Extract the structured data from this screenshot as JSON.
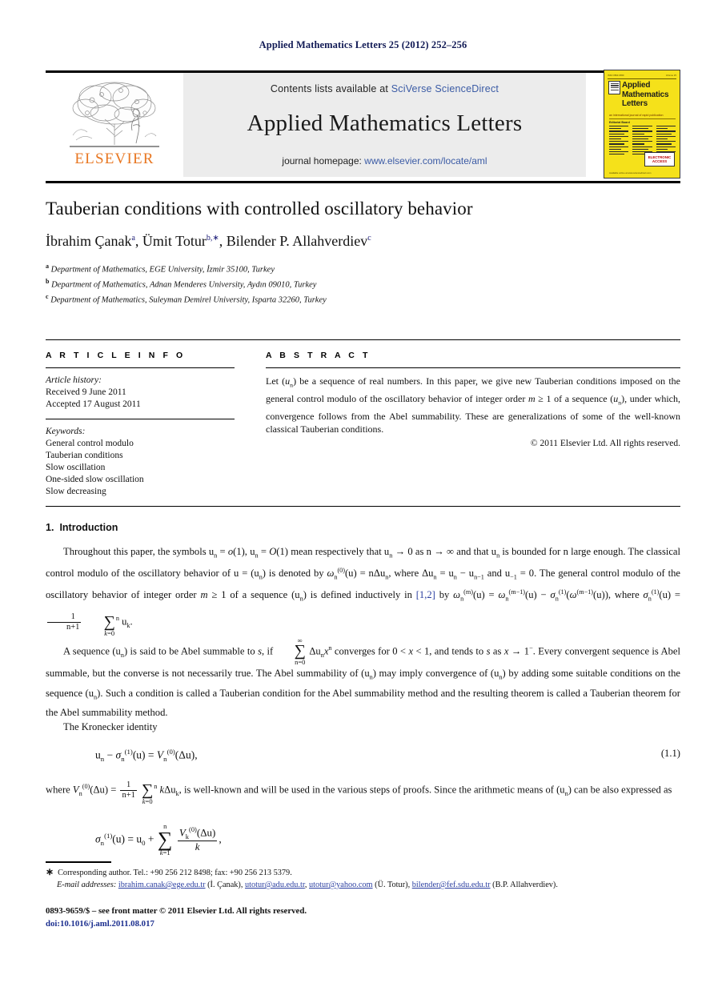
{
  "running_head": "Applied Mathematics Letters 25 (2012) 252–256",
  "masthead": {
    "publisher_name": "ELSEVIER",
    "contents_prefix": "Contents lists available at ",
    "contents_link": "SciVerse ScienceDirect",
    "journal_title": "Applied Mathematics Letters",
    "homepage_prefix": "journal homepage: ",
    "homepage_link": "www.elsevier.com/locate/aml",
    "cover": {
      "title": "Applied Mathematics Letters",
      "subtitle": "an international journal of rapid publication",
      "board_label": "Editorial Board",
      "access_badge": "ELECTRONIC ACCESS",
      "top_left": "ISSN 0893-9659",
      "top_right": "Volume 25",
      "footer": "Available online at www.sciencedirect.com"
    }
  },
  "article": {
    "title": "Tauberian conditions with controlled oscillatory behavior",
    "authors": [
      {
        "name": "İbrahim Çanak",
        "marks": "a"
      },
      {
        "name": "Ümit Totur",
        "marks": "b"
      },
      {
        "name": "Bilender P. Allahverdiev",
        "marks": "c"
      }
    ],
    "authors_line_prefix": "İbrahim Çanak",
    "affiliations": [
      {
        "mark": "a",
        "text": "Department of Mathematics, EGE University, İzmir 35100, Turkey"
      },
      {
        "mark": "b",
        "text": "Department of Mathematics, Adnan Menderes University, Aydın 09010, Turkey"
      },
      {
        "mark": "c",
        "text": "Department of Mathematics, Suleyman Demirel University, Isparta 32260, Turkey"
      }
    ]
  },
  "info": {
    "heading": "A R T I C L E   I N F O",
    "history_label": "Article history:",
    "history": [
      "Received 9 June 2011",
      "Accepted 17 August 2011"
    ],
    "keywords_label": "Keywords:",
    "keywords": [
      "General control modulo",
      "Tauberian conditions",
      "Slow oscillation",
      "One-sided slow oscillation",
      "Slow decreasing"
    ]
  },
  "abstract": {
    "heading": "A B S T R A C T",
    "text": "Let (uₙ) be a sequence of real numbers. In this paper, we give new Tauberian conditions imposed on the general control modulo of the oscillatory behavior of integer order m ≥ 1 of a sequence (uₙ), under which, convergence follows from the Abel summability. These are generalizations of some of the well-known classical Tauberian conditions.",
    "copyright": "© 2011 Elsevier Ltd. All rights reserved."
  },
  "sections": {
    "intro": {
      "number": "1.",
      "title": "Introduction",
      "p1_a": "Throughout this paper, the symbols u",
      "p1_full": "Throughout this paper, the symbols uₙ = o(1), uₙ = O(1) mean respectively that uₙ → 0 as n → ∞ and that uₙ is bounded for n large enough. The classical control modulo of the oscillatory behavior of u = (uₙ) is denoted by ω⁽⁰⁾ₙ(u) = nΔuₙ, where Δuₙ = uₙ − uₙ₋₁ and u₋₁ = 0. The general control modulo of the oscillatory behavior of integer order m ≥ 1 of a sequence (uₙ) is defined inductively in [1,2] by ω⁽ᵐ⁾ₙ(u) = ω⁽ᵐ⁻¹⁾ₙ(u) − σ⁽¹⁾ₙ(ω⁽ᵐ⁻¹⁾(u)), where σ⁽¹⁾ₙ(u) = 1/(n+1) Σₖ₌₀ⁿ uₖ.",
      "citation": "[1,2]",
      "p2_full": "A sequence (uₙ) is said to be Abel summable to s, if Σ∞ₙ₌₀ Δuₙxⁿ converges for 0 < x < 1, and tends to s as x → 1⁻. Every convergent sequence is Abel summable, but the converse is not necessarily true. The Abel summability of (uₙ) may imply convergence of (uₙ) by adding some suitable conditions on the sequence (uₙ). Such a condition is called a Tauberian condition for the Abel summability method and the resulting theorem is called a Tauberian theorem for the Abel summability method.",
      "p3": "The Kronecker identity",
      "eq11_number": "(1.1)",
      "p4_full": "where V⁽⁰⁾ₙ(Δu) = 1/(n+1) Σₖ₌₀ⁿ kΔuₖ, is well-known and will be used in the various steps of proofs. Since the arithmetic means of (uₙ) can be also expressed as"
    }
  },
  "footnotes": {
    "corresponding": "Corresponding author. Tel.: +90 256 212 8498; fax: +90 256 213 5379.",
    "email_label": "E-mail addresses:",
    "emails": [
      {
        "address": "ibrahim.canak@ege.edu.tr",
        "owner": "(İ. Çanak)"
      },
      {
        "address": "utotur@adu.edu.tr",
        "owner": ""
      },
      {
        "address": "utotur@yahoo.com",
        "owner": "(Ü. Totur)"
      },
      {
        "address": "bilender@fef.sdu.edu.tr",
        "owner": "(B.P. Allahverdiev)"
      }
    ]
  },
  "footer": {
    "copyright": "0893-9659/$ – see front matter © 2011 Elsevier Ltd. All rights reserved.",
    "doi": "doi:10.1016/j.aml.2011.08.017"
  }
}
